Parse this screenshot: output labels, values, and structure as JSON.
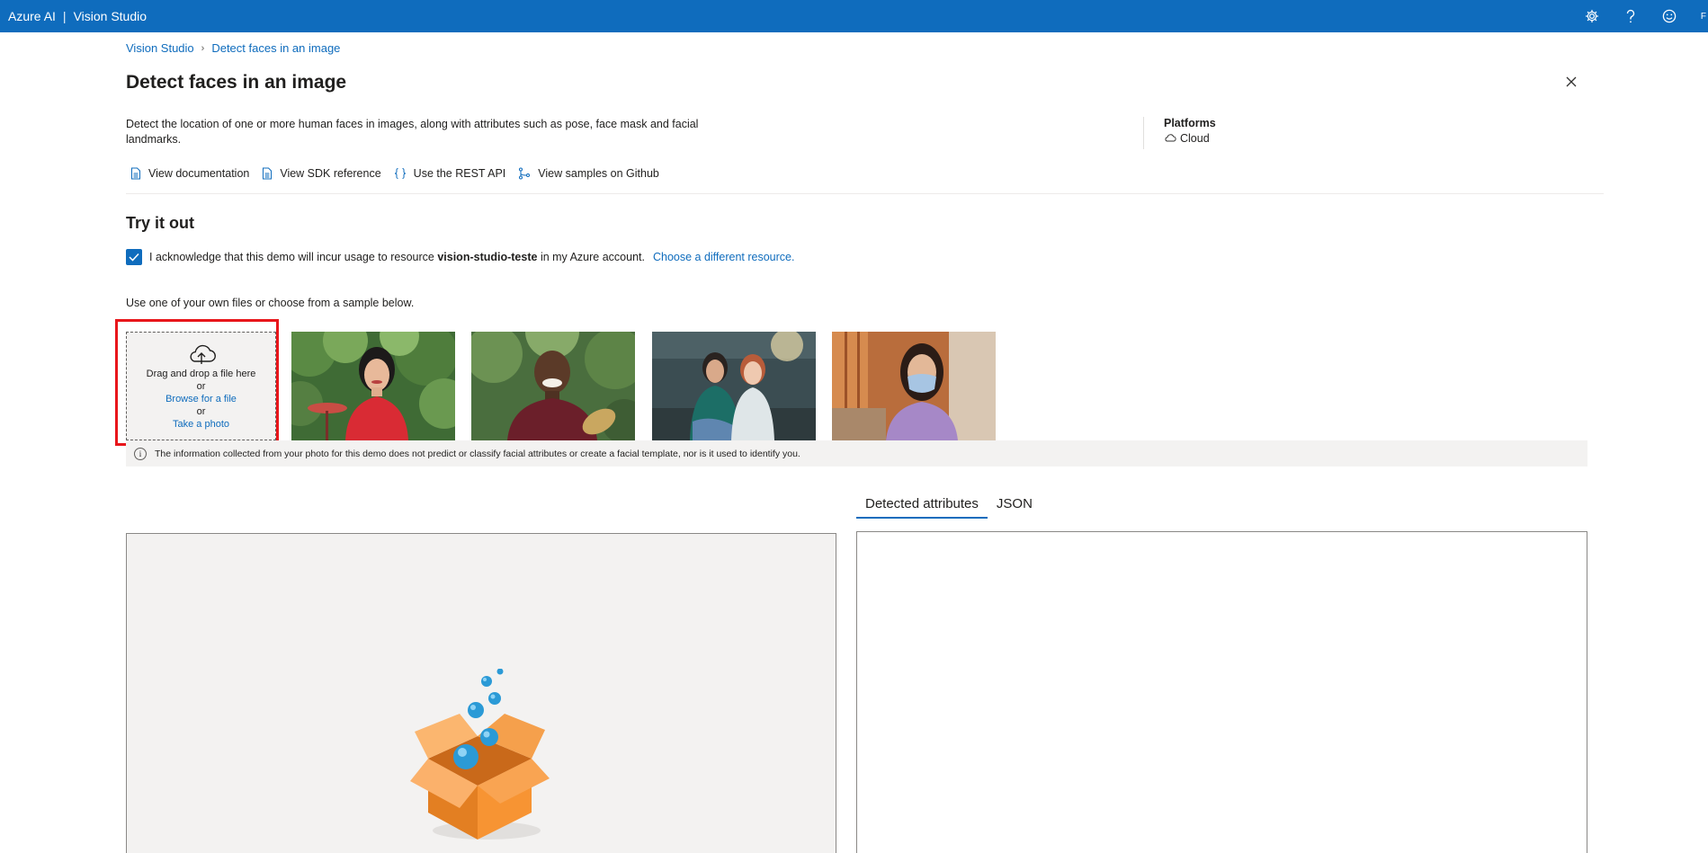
{
  "app": {
    "brand": "Azure AI",
    "separator": "|",
    "product": "Vision Studio",
    "user_initial": "F"
  },
  "topbar_icons": [
    "gear-icon",
    "help-icon",
    "feedback-smiley-icon"
  ],
  "breadcrumb": {
    "items": [
      "Vision Studio",
      "Detect faces in an image"
    ]
  },
  "page": {
    "title": "Detect faces in an image",
    "description": "Detect the location of one or more human faces in images, along with attributes such as pose, face mask and facial landmarks.",
    "platforms_title": "Platforms",
    "platform": "Cloud"
  },
  "links": [
    {
      "label": "View documentation",
      "icon": "document-icon"
    },
    {
      "label": "View SDK reference",
      "icon": "document-icon"
    },
    {
      "label": "Use the REST API",
      "icon": "braces-icon"
    },
    {
      "label": "View samples on Github",
      "icon": "branch-icon"
    }
  ],
  "try_it": {
    "title": "Try it out",
    "ack_prefix": "I acknowledge that this demo will incur usage to resource",
    "resource_name": "vision-studio-teste",
    "ack_suffix": "in my Azure account.",
    "change_resource": "Choose a different resource.",
    "checked": true,
    "hint": "Use one of your own files or choose from a sample below."
  },
  "upload": {
    "drag_text": "Drag and drop a file here",
    "or1": "or",
    "browse": "Browse for a file",
    "or2": "or",
    "take_photo": "Take a photo"
  },
  "samples": [
    "sample-woman-red-dress",
    "sample-man-smiling",
    "sample-two-women-office",
    "sample-woman-face-mask"
  ],
  "info_text": "The information collected from your photo for this demo does not predict or classify facial attributes or create a facial template, nor is it used to identify you.",
  "tabs": [
    {
      "label": "Detected attributes",
      "active": true
    },
    {
      "label": "JSON",
      "active": false
    }
  ],
  "colors": {
    "accent": "#0f6cbd",
    "highlight": "#e8161b",
    "panel_bg": "#f3f2f1"
  }
}
